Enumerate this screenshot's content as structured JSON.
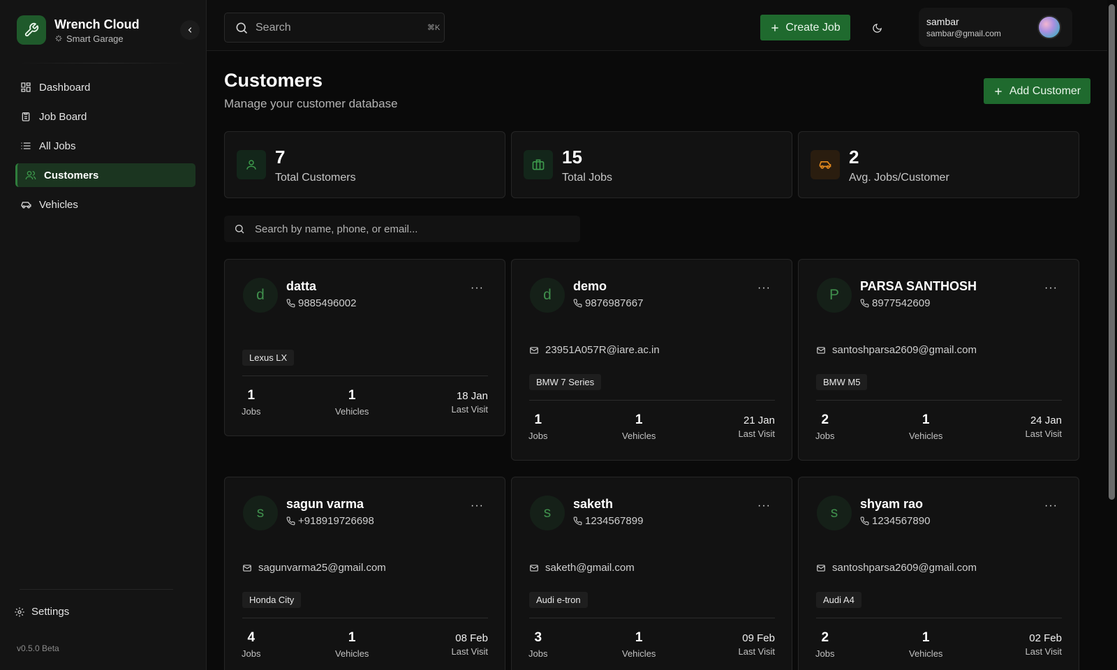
{
  "app": {
    "name": "Wrench Cloud",
    "subtitle": "Smart Garage",
    "version": "v0.5.0 Beta"
  },
  "sidebar": {
    "items": [
      {
        "label": "Dashboard",
        "icon": "dashboard-icon"
      },
      {
        "label": "Job Board",
        "icon": "clipboard-icon"
      },
      {
        "label": "All Jobs",
        "icon": "list-icon"
      },
      {
        "label": "Customers",
        "icon": "users-icon",
        "active": true
      },
      {
        "label": "Vehicles",
        "icon": "car-icon"
      }
    ],
    "settings_label": "Settings"
  },
  "topbar": {
    "search_placeholder": "Search",
    "search_shortcut": "⌘K",
    "create_job_label": "Create Job",
    "user": {
      "name": "sambar",
      "email": "sambar@gmail.com"
    }
  },
  "page": {
    "title": "Customers",
    "subtitle": "Manage your customer database",
    "add_customer_label": "Add Customer",
    "search_placeholder": "Search by name, phone, or email..."
  },
  "stats": [
    {
      "value": "7",
      "label": "Total Customers",
      "icon": "user-icon",
      "color": "#2f8a40"
    },
    {
      "value": "15",
      "label": "Total Jobs",
      "icon": "briefcase-icon",
      "color": "#2f8a40"
    },
    {
      "value": "2",
      "label": "Avg. Jobs/Customer",
      "icon": "car-icon",
      "color": "#e38a1e"
    }
  ],
  "customers": [
    {
      "initial": "d",
      "name": "datta",
      "phone": "9885496002",
      "email": "",
      "vehicle": "Lexus LX",
      "jobs": "1",
      "jobs_label": "Jobs",
      "vehicles": "1",
      "vehicles_label": "Vehicles",
      "last_visit": "18 Jan",
      "last_visit_label": "Last Visit"
    },
    {
      "initial": "d",
      "name": "demo",
      "phone": "9876987667",
      "email": "23951A057R@iare.ac.in",
      "vehicle": "BMW 7 Series",
      "jobs": "1",
      "jobs_label": "Jobs",
      "vehicles": "1",
      "vehicles_label": "Vehicles",
      "last_visit": "21 Jan",
      "last_visit_label": "Last Visit"
    },
    {
      "initial": "P",
      "name": "PARSA SANTHOSH",
      "phone": "8977542609",
      "email": "santoshparsa2609@gmail.com",
      "vehicle": "BMW M5",
      "jobs": "2",
      "jobs_label": "Jobs",
      "vehicles": "1",
      "vehicles_label": "Vehicles",
      "last_visit": "24 Jan",
      "last_visit_label": "Last Visit"
    },
    {
      "initial": "s",
      "name": "sagun varma",
      "phone": "+918919726698",
      "email": "sagunvarma25@gmail.com",
      "vehicle": "Honda City",
      "jobs": "4",
      "jobs_label": "Jobs",
      "vehicles": "1",
      "vehicles_label": "Vehicles",
      "last_visit": "08 Feb",
      "last_visit_label": "Last Visit"
    },
    {
      "initial": "s",
      "name": "saketh",
      "phone": "1234567899",
      "email": "saketh@gmail.com",
      "vehicle": "Audi e-tron",
      "jobs": "3",
      "jobs_label": "Jobs",
      "vehicles": "1",
      "vehicles_label": "Vehicles",
      "last_visit": "09 Feb",
      "last_visit_label": "Last Visit"
    },
    {
      "initial": "s",
      "name": "shyam rao",
      "phone": "1234567890",
      "email": "santoshparsa2609@gmail.com",
      "vehicle": "Audi A4",
      "jobs": "2",
      "jobs_label": "Jobs",
      "vehicles": "1",
      "vehicles_label": "Vehicles",
      "last_visit": "02 Feb",
      "last_visit_label": "Last Visit"
    }
  ],
  "card_menu_label": "···"
}
